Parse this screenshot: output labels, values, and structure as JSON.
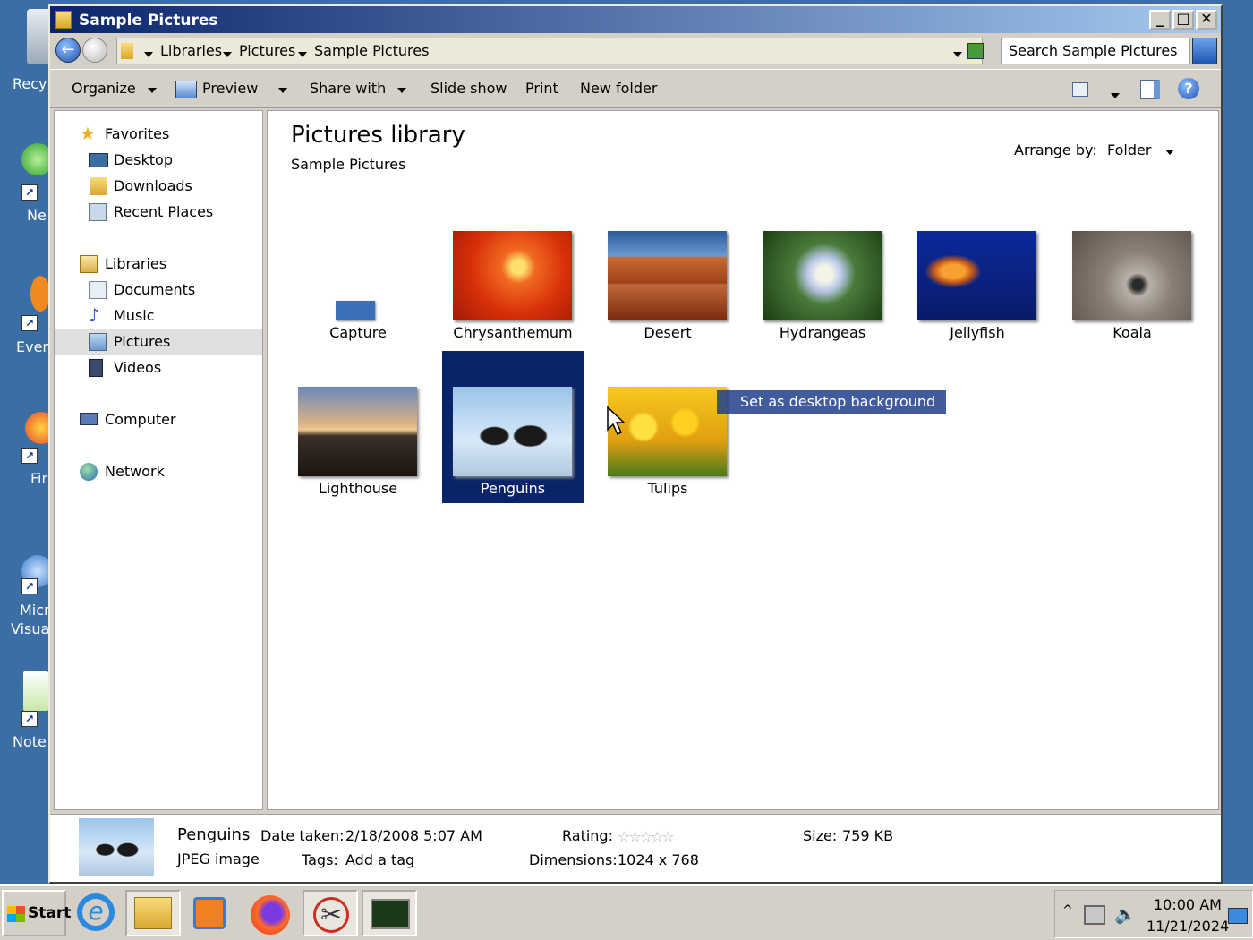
{
  "desktop": {
    "icons": [
      {
        "label": "Recy",
        "name": "recycle-bin"
      },
      {
        "label": "Ne",
        "name": "network"
      },
      {
        "label": "Ever",
        "name": "everything"
      },
      {
        "label": "Fir",
        "name": "firefox"
      },
      {
        "label": "Micr",
        "label2": "Visua",
        "name": "visual-studio"
      },
      {
        "label": "Note",
        "name": "notepad-plus-plus"
      }
    ]
  },
  "window": {
    "title": "Sample Pictures",
    "controls": {
      "minimize": "_",
      "maximize": "□",
      "close": "✕"
    }
  },
  "address": {
    "breadcrumbs": [
      "Libraries",
      "Pictures",
      "Sample Pictures"
    ],
    "search_placeholder": "Search Sample Pictures"
  },
  "toolbar": {
    "organize": "Organize",
    "preview": "Preview",
    "share_with": "Share with",
    "slide_show": "Slide show",
    "print": "Print",
    "new_folder": "New folder"
  },
  "nav": {
    "favorites": "Favorites",
    "desktop": "Desktop",
    "downloads": "Downloads",
    "recent_places": "Recent Places",
    "libraries": "Libraries",
    "documents": "Documents",
    "music": "Music",
    "pictures": "Pictures",
    "videos": "Videos",
    "computer": "Computer",
    "network": "Network"
  },
  "content": {
    "title": "Pictures library",
    "subtitle": "Sample Pictures",
    "arrange_label": "Arrange by:",
    "arrange_value": "Folder",
    "items": [
      {
        "label": "Capture"
      },
      {
        "label": "Chrysanthemum"
      },
      {
        "label": "Desert"
      },
      {
        "label": "Hydrangeas"
      },
      {
        "label": "Jellyfish"
      },
      {
        "label": "Koala"
      },
      {
        "label": "Lighthouse"
      },
      {
        "label": "Penguins",
        "selected": true
      },
      {
        "label": "Tulips"
      }
    ],
    "tooltip": "Set as desktop background"
  },
  "details": {
    "name": "Penguins",
    "type": "JPEG image",
    "date_label": "Date taken:",
    "date_value": "2/18/2008 5:07 AM",
    "tags_label": "Tags:",
    "tags_value": "Add a tag",
    "rating_label": "Rating:",
    "rating_stars": "☆☆☆☆☆",
    "dimensions_label": "Dimensions:",
    "dimensions_value": "1024 x 768",
    "size_label": "Size:",
    "size_value": "759 KB"
  },
  "taskbar": {
    "start": "Start",
    "time": "10:00 AM",
    "date": "11/21/2024"
  },
  "colors": {
    "selection": "#0a246a",
    "title_start": "#0a246a",
    "title_end": "#a6caf0"
  }
}
